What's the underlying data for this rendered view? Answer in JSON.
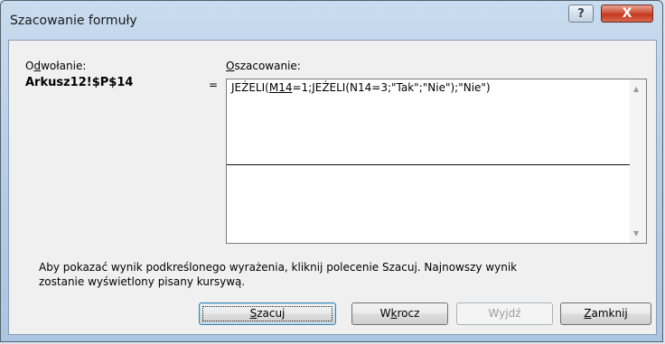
{
  "window": {
    "title": "Szacowanie formuły",
    "help_glyph": "?",
    "close_glyph": "X"
  },
  "reference": {
    "label_pre": "O",
    "label_accel": "d",
    "label_post": "wołanie:",
    "value": "Arkusz12!$P$14",
    "equals": "="
  },
  "evaluation": {
    "label_accel": "O",
    "label_post": "szacowanie:",
    "formula_pre": "JEŻELI(",
    "formula_underlined": "M14",
    "formula_post": "=1;JEŻELI(N14=3;\"Tak\";\"Nie\");\"Nie\")"
  },
  "hint": {
    "line1": "Aby pokazać wynik podkreślonego wyrażenia, kliknij polecenie Szacuj. Najnowszy wynik",
    "line2": "zostanie wyświetlony pisany kursywą."
  },
  "buttons": {
    "evaluate": {
      "accel": "S",
      "rest": "zacuj"
    },
    "step_in": {
      "pre": "W",
      "accel": "k",
      "rest": "rocz"
    },
    "step_out": {
      "label": "Wyjdź"
    },
    "close": {
      "accel": "Z",
      "rest": "amknij"
    }
  },
  "icons": {
    "scroll_up": "scroll-up-arrow-icon",
    "scroll_down": "scroll-down-arrow-icon"
  }
}
